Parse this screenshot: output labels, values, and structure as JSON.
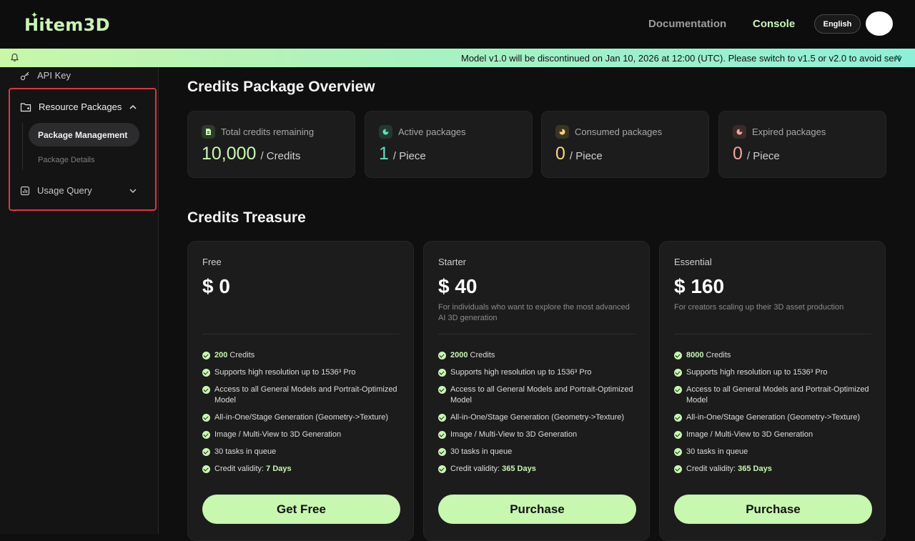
{
  "header": {
    "logo_text": "Hitem3D",
    "nav": {
      "documentation": "Documentation",
      "console": "Console"
    },
    "language": "English"
  },
  "banner": {
    "message": "Model v1.0 will be discontinued on Jan 10, 2026 at 12:00 (UTC). Please switch to v1.5 or v2.0 to avoid serv",
    "close": "×"
  },
  "sidebar": {
    "api_key": "API Key",
    "resource_packages": "Resource Packages",
    "package_management": "Package Management",
    "package_details": "Package Details",
    "usage_query": "Usage Query"
  },
  "overview": {
    "title": "Credits Package Overview",
    "stats": [
      {
        "label": "Total credits remaining",
        "value": "10,000",
        "unit": "/ Credits",
        "color": "#c8f7b0"
      },
      {
        "label": "Active packages",
        "value": "1",
        "unit": "/ Piece",
        "color": "#5ee0c0"
      },
      {
        "label": "Consumed packages",
        "value": "0",
        "unit": "/ Piece",
        "color": "#f5d67a"
      },
      {
        "label": "Expired packages",
        "value": "0",
        "unit": "/ Piece",
        "color": "#f0a59a"
      }
    ]
  },
  "treasure": {
    "title": "Credits Treasure",
    "plans": [
      {
        "name": "Free",
        "price": "$ 0",
        "desc": "",
        "credits": "200",
        "credits_label": "Credits",
        "features": [
          "Supports high resolution up to 1536³ Pro",
          "Access to all General Models and Portrait-Optimized Model",
          "All-in-One/Stage Generation (Geometry->Texture)",
          "Image / Multi-View to 3D Generation",
          "30 tasks in queue"
        ],
        "validity_label": "Credit validity:",
        "validity": "7 Days",
        "button": "Get Free"
      },
      {
        "name": "Starter",
        "price": "$ 40",
        "desc": "For individuals who want to explore the most advanced AI 3D generation",
        "credits": "2000",
        "credits_label": "Credits",
        "features": [
          "Supports high resolution up to 1536³ Pro",
          "Access to all General Models and Portrait-Optimized Model",
          "All-in-One/Stage Generation (Geometry->Texture)",
          "Image / Multi-View to 3D Generation",
          "30 tasks in queue"
        ],
        "validity_label": "Credit validity:",
        "validity": "365 Days",
        "button": "Purchase"
      },
      {
        "name": "Essential",
        "price": "$ 160",
        "desc": "For creators scaling up their 3D asset production",
        "credits": "8000",
        "credits_label": "Credits",
        "features": [
          "Supports high resolution up to 1536³ Pro",
          "Access to all General Models and Portrait-Optimized Model",
          "All-in-One/Stage Generation (Geometry->Texture)",
          "Image / Multi-View to 3D Generation",
          "30 tasks in queue"
        ],
        "validity_label": "Credit validity:",
        "validity": "365 Days",
        "button": "Purchase"
      }
    ]
  },
  "icons": {
    "bell": "bell-icon",
    "key": "key-icon",
    "folder": "folder-icon",
    "chart": "chart-icon",
    "chevron_up": "chevron-up-icon",
    "chevron_down": "chevron-down-icon",
    "check": "check-circle-icon"
  }
}
